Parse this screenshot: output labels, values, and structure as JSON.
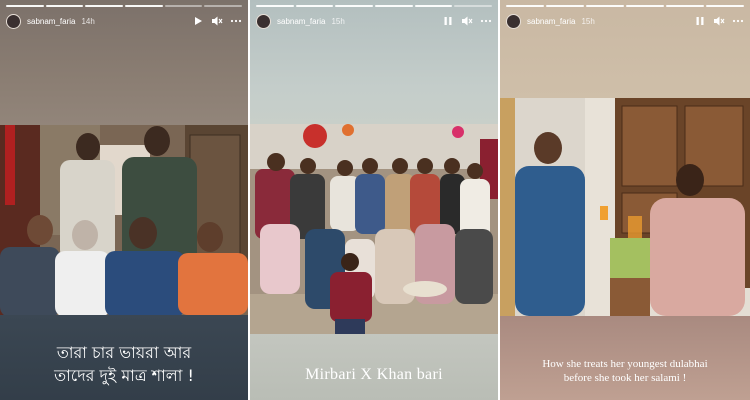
{
  "stories": [
    {
      "username": "sabnam_faria",
      "time": "14h",
      "caption_lines": [
        "তারা চার ভায়রা আর",
        "তাদের দুই মাত্র শালা !"
      ],
      "state": "paused"
    },
    {
      "username": "sabnam_faria",
      "time": "15h",
      "caption_lines": [
        "Mirbari X Khan bari"
      ],
      "state": "playing"
    },
    {
      "username": "sabnam_faria",
      "time": "15h",
      "caption_lines": [
        "How she treats her youngest dulabhai",
        "before she took her salami !"
      ],
      "state": "playing"
    }
  ],
  "icons": {
    "play": "play-icon",
    "pause": "pause-icon",
    "volume": "volume-mute-icon",
    "more": "more-icon"
  }
}
